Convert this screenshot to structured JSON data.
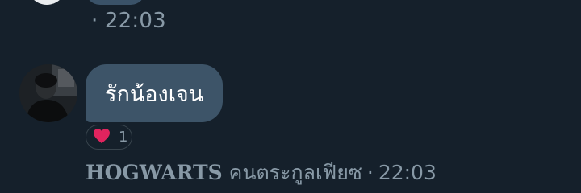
{
  "previous_message": {
    "timestamp_text": "· 22:03"
  },
  "message": {
    "text": "รักน้องเจน",
    "reaction": {
      "icon": "heart-icon",
      "color": "#e0245e",
      "count": "1"
    },
    "sender": {
      "name": "HOGWARTS",
      "subtitle": "คนตระกูลเฟียซ"
    },
    "separator": "·",
    "time": "22:03"
  },
  "colors": {
    "background": "#15202b",
    "bubble": "#3d5468",
    "muted_text": "#8899a6"
  }
}
